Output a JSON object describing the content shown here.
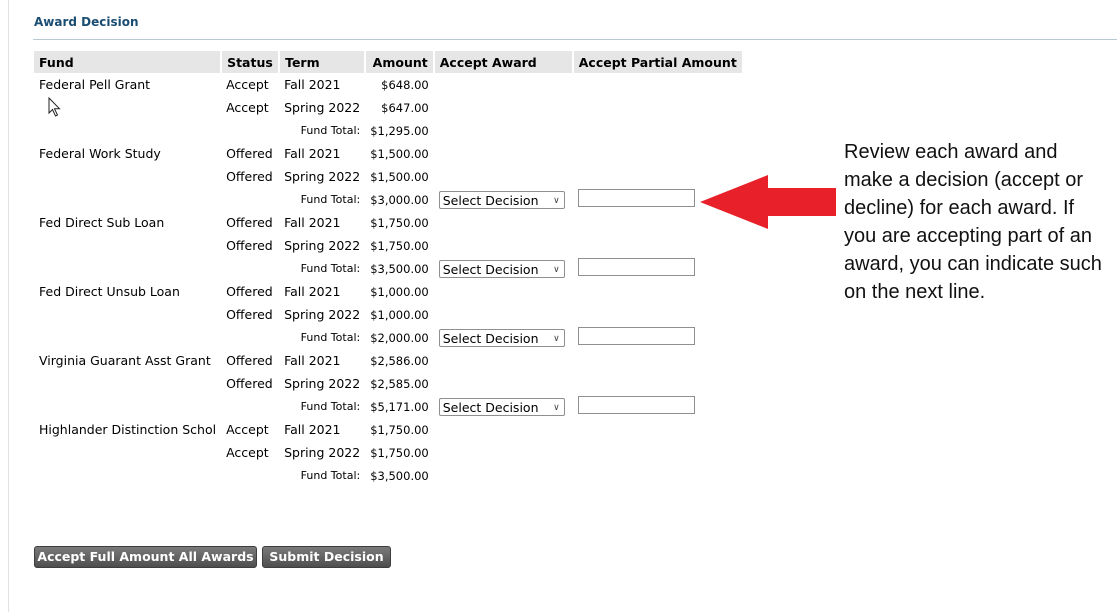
{
  "section": {
    "title": "Award Decision"
  },
  "table": {
    "headers": {
      "fund": "Fund",
      "status": "Status",
      "term": "Term",
      "amount": "Amount",
      "accept": "Accept Award",
      "partial": "Accept Partial Amount"
    },
    "total_label": "Fund Total:",
    "funds": [
      {
        "name": "Federal Pell Grant",
        "rows": [
          {
            "status": "Accept",
            "term": "Fall 2021",
            "amount": "$648.00"
          },
          {
            "status": "Accept",
            "term": "Spring 2022",
            "amount": "$647.00"
          }
        ],
        "total": "$1,295.00",
        "has_decision": false
      },
      {
        "name": "Federal Work Study",
        "rows": [
          {
            "status": "Offered",
            "term": "Fall 2021",
            "amount": "$1,500.00"
          },
          {
            "status": "Offered",
            "term": "Spring 2022",
            "amount": "$1,500.00"
          }
        ],
        "total": "$3,000.00",
        "has_decision": true,
        "decision": "Select Decision"
      },
      {
        "name": "Fed Direct Sub Loan",
        "rows": [
          {
            "status": "Offered",
            "term": "Fall 2021",
            "amount": "$1,750.00"
          },
          {
            "status": "Offered",
            "term": "Spring 2022",
            "amount": "$1,750.00"
          }
        ],
        "total": "$3,500.00",
        "has_decision": true,
        "decision": "Select Decision"
      },
      {
        "name": "Fed Direct Unsub Loan",
        "rows": [
          {
            "status": "Offered",
            "term": "Fall 2021",
            "amount": "$1,000.00"
          },
          {
            "status": "Offered",
            "term": "Spring 2022",
            "amount": "$1,000.00"
          }
        ],
        "total": "$2,000.00",
        "has_decision": true,
        "decision": "Select Decision"
      },
      {
        "name": "Virginia Guarant Asst Grant",
        "rows": [
          {
            "status": "Offered",
            "term": "Fall 2021",
            "amount": "$2,586.00"
          },
          {
            "status": "Offered",
            "term": "Spring 2022",
            "amount": "$2,585.00"
          }
        ],
        "total": "$5,171.00",
        "has_decision": true,
        "decision": "Select Decision"
      },
      {
        "name": "Highlander Distinction Schol",
        "rows": [
          {
            "status": "Accept",
            "term": "Fall 2021",
            "amount": "$1,750.00"
          },
          {
            "status": "Accept",
            "term": "Spring 2022",
            "amount": "$1,750.00"
          }
        ],
        "total": "$3,500.00",
        "has_decision": false
      }
    ]
  },
  "buttons": {
    "accept_all": "Accept Full Amount All Awards",
    "submit": "Submit Decision"
  },
  "callout": {
    "text": "Review each award and make a decision (accept or decline) for each award. If you are accepting part of an award, you can indicate such on the next line.",
    "arrow_color": "#e8202a"
  },
  "colors": {
    "title": "#1b4d72",
    "header_bg": "#e6e6e6",
    "button_bg": "#5a5a5a"
  }
}
